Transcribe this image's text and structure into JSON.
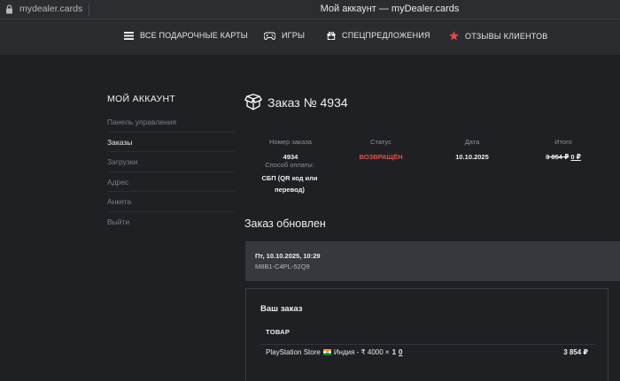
{
  "browser": {
    "url": "mydealer.cards",
    "window_title": "Мой аккаунт — myDealer.cards"
  },
  "nav": {
    "items": [
      {
        "label": "ВСЕ ПОДАРОЧНЫЕ КАРТЫ",
        "icon": "menu-icon"
      },
      {
        "label": "ИГРЫ",
        "icon": "gamepad-icon"
      },
      {
        "label": "СПЕЦПРЕДЛОЖЕНИЯ",
        "icon": "gift-icon"
      },
      {
        "label": "ОТЗЫВЫ КЛИЕНТОВ",
        "icon": "star-icon"
      }
    ],
    "star_color": "#e8474c"
  },
  "sidebar": {
    "title": "МОЙ АККАУНТ",
    "items": [
      {
        "label": "Панель управления",
        "active": false
      },
      {
        "label": "Заказы",
        "active": true
      },
      {
        "label": "Загрузки",
        "active": false
      },
      {
        "label": "Адрес",
        "active": false
      },
      {
        "label": "Анкета",
        "active": false
      },
      {
        "label": "Выйти",
        "active": false
      }
    ]
  },
  "order": {
    "title": "Заказ № 4934",
    "number_label": "Номер заказа",
    "number": "4934",
    "status_label": "Статус",
    "status": "ВОЗВРАЩЁН",
    "status_color": "#e0524c",
    "date_label": "Дата",
    "date": "10.10.2025",
    "total_label": "Итого",
    "total_old": "3 854 ₽",
    "total_new": "0 ₽",
    "payment_label": "Способ оплаты:",
    "payment_line1": "СБП (QR код или",
    "payment_line2": "перевод)"
  },
  "update": {
    "heading": "Заказ обновлен",
    "datetime": "Пт, 10.10.2025, 10:29",
    "code": "M8B1-C4PL-52Q9"
  },
  "your_order": {
    "title": "Ваш заказ",
    "column_header": "ТОВАР",
    "product_prefix": "PlayStation Store",
    "product_suffix": "Индия - ₹ 4000 ×",
    "quantity": "1",
    "quantity_struck": "0",
    "price": "3 854 ₽"
  }
}
